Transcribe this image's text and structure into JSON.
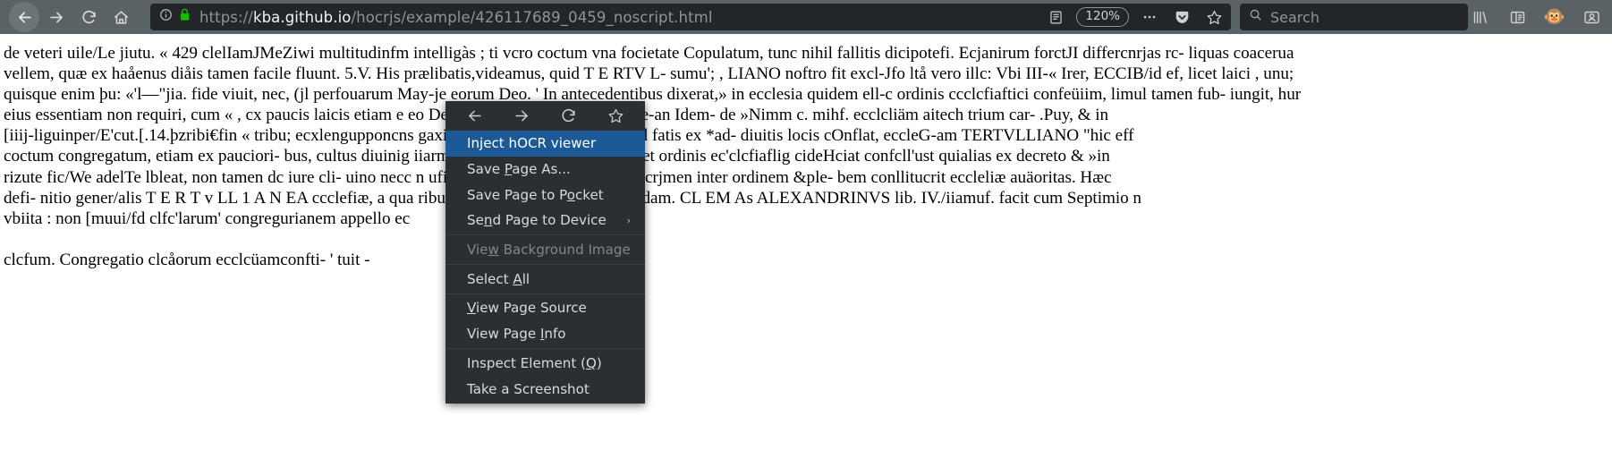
{
  "browser": {
    "nav": {
      "back_label": "Back",
      "forward_label": "Forward",
      "reload_label": "Reload",
      "home_label": "Home"
    },
    "urlbar": {
      "scheme": "https://",
      "host": "kba.github.io",
      "path": "/hocrjs/example/426117689_0459_noscript.html",
      "full_url": "https://kba.github.io/hocrjs/example/426117689_0459_noscript.html",
      "identity_icon": "info-circle-icon",
      "lock_icon": "lock-icon",
      "lock_color": "#12bc00",
      "reader_view_label": "Reader View",
      "zoom_level": "120%",
      "more_actions_label": "…",
      "pocket_label": "Save to Pocket",
      "bookmark_label": "Bookmark this page"
    },
    "search": {
      "placeholder": "Search",
      "icon": "search-icon"
    },
    "toolbar_right": {
      "library_label": "Library",
      "sidebar_label": "Sidebars",
      "extension_label": "Greasemonkey",
      "extension_glyph": "🐵",
      "account_label": "Account"
    },
    "theme": {
      "chrome_bg": "#5b6265",
      "field_bg": "#232628",
      "menu_bg": "#2b2f31",
      "accent": "#1b5a96"
    }
  },
  "context_menu": {
    "nav_icons": [
      {
        "name": "back-icon",
        "glyph": "←",
        "label": "Back"
      },
      {
        "name": "forward-icon",
        "glyph": "→",
        "label": "Forward"
      },
      {
        "name": "reload-icon",
        "glyph": "⟳",
        "label": "Reload"
      },
      {
        "name": "bookmark-icon",
        "glyph": "☆",
        "label": "Bookmark Page"
      }
    ],
    "items": [
      {
        "label": "Inject hOCR viewer",
        "pre": "Inject hOCR viewer",
        "acc": "",
        "post": "",
        "selected": true,
        "disabled": false,
        "submenu": false
      },
      {
        "label": "Save Page As...",
        "pre": "Save ",
        "acc": "P",
        "post": "age As...",
        "selected": false,
        "disabled": false,
        "submenu": false
      },
      {
        "label": "Save Page to Pocket",
        "pre": "Save Page to P",
        "acc": "o",
        "post": "cket",
        "selected": false,
        "disabled": false,
        "submenu": false
      },
      {
        "label": "Send Page to Device",
        "pre": "Se",
        "acc": "n",
        "post": "d Page to Device",
        "selected": false,
        "disabled": false,
        "submenu": true
      },
      {
        "label": "View Background Image",
        "pre": "Vie",
        "acc": "w",
        "post": " Background Image",
        "selected": false,
        "disabled": true,
        "submenu": false
      },
      {
        "label": "Select All",
        "pre": "Select ",
        "acc": "A",
        "post": "ll",
        "selected": false,
        "disabled": false,
        "submenu": false
      },
      {
        "label": "View Page Source",
        "pre": "",
        "acc": "V",
        "post": "iew Page Source",
        "selected": false,
        "disabled": false,
        "submenu": false
      },
      {
        "label": "View Page Info",
        "pre": "View Page ",
        "acc": "I",
        "post": "nfo",
        "selected": false,
        "disabled": false,
        "submenu": false
      },
      {
        "label": "Inspect Element (Q)",
        "pre": "Inspect Element (",
        "acc": "Q",
        "post": ")",
        "selected": false,
        "disabled": false,
        "submenu": false
      },
      {
        "label": "Take a Screenshot",
        "pre": "Take a Screenshot",
        "acc": "",
        "post": "",
        "selected": false,
        "disabled": false,
        "submenu": false
      }
    ],
    "separators_after": [
      3,
      4,
      5,
      7
    ]
  },
  "document": {
    "lines": [
      "de veteri uile/Le jiutu. « 429 clelIamJMeZiwi multitudinfm intelligàs ; ti vcro coctum vna focietate Copulatum, tunc nihil fallitis dicipotefi. Ecjanirum forctJI differcnrjas rc- liquas coacerua",
      "vellem, quæ ex haåenus diåis tamen facile fluunt. 5.V. His prælibatis,videamus, quid T E RTV L- sumu'; , LIANO noftro fit excl-Jfo ltå vero illc: Vbi III-« Irer, ECCIB/id ef, licet laici , unu;",
      "quisque enim þu: «'l—\"jia. fide viuit, nec, (jl perfouarum May-je eorum Deo. ' In antecedentibus dixerat,» in ecclesia quidem ell-c ordinis ccclcfiaftici confeüiim, limul tamen fub- iungit, hur",
      "eius essentiam non requiri, cum « , cx paucis laicis etiam e                                        eo Deus perfonarum rationem habe-an Idem- de »Nimm c. mihf. ecclcliäm aitech trium car- .Puy, & in",
      "[iiij-liguinper/E'cut.[.14.þzribi€fin « tribu; ecxlengupponcns                                       gaxifideles non pollint. Interim id fatis ex *ad- diuitis locis cOnflat, eccleG-am TERTVLLIANO \"hic eff",
      "coctum congregatum, etiam ex pauciori- bus, cultus diuinig                                      iiarm Pcrfeäam conllituere ait, licet ordinis ec'clcfiaflig cideHciat confcll'ust quialias ex decreto & »in",
      "rizute fic/We adelTe lbleat, non tamen dc iure cli- uino necc                                  n ufier/imm abe/llt. polny cum decrjmen inter ordinem &ple- bem conllitucrit eccleliæ auäoritas. Hæc",
      "defi- nitio gener/alis T E R T v LL 1 A N EA ccclefiæ, a qua                                  ribus difcelliim efi,vti infra ottendam. CL EM As ALEXANDRINVS lib. IV./iiamuf. facit cum Septimio n",
      "vbiita : non [muui/fd clfc'larum' congregurianem appello ec"
    ],
    "trailing_line": "clcfum. Congregatio clcåorum ecclcüamconfti- ' tuit -"
  }
}
